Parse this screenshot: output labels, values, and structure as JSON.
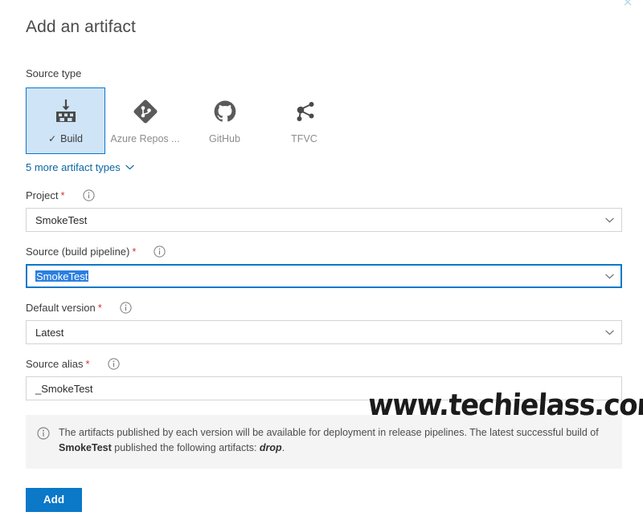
{
  "window": {
    "close_label": "✕"
  },
  "panel": {
    "title": "Add an artifact",
    "source_type_label": "Source type",
    "more_types_link": "5 more artifact types"
  },
  "source_types": [
    {
      "label": "Build",
      "icon": "build-icon",
      "selected": true,
      "check": "✓"
    },
    {
      "label": "Azure Repos ...",
      "icon": "azure-repos-icon",
      "selected": false
    },
    {
      "label": "GitHub",
      "icon": "github-icon",
      "selected": false
    },
    {
      "label": "TFVC",
      "icon": "tfvc-icon",
      "selected": false
    }
  ],
  "fields": {
    "project": {
      "label": "Project",
      "required": "*",
      "value": "SmokeTest",
      "type": "dropdown"
    },
    "source_build_pipeline": {
      "label": "Source (build pipeline)",
      "required": "*",
      "value": "SmokeTest",
      "type": "dropdown",
      "focused": true,
      "text_selected": true
    },
    "default_version": {
      "label": "Default version",
      "required": "*",
      "value": "Latest",
      "type": "dropdown"
    },
    "source_alias": {
      "label": "Source alias",
      "required": "*",
      "value": "_SmokeTest",
      "type": "text"
    }
  },
  "info_banner": {
    "icon": "info-icon",
    "text_part1": "The artifacts published by each version will be available for deployment in release pipelines. The latest successful build of ",
    "bold_build": "SmokeTest",
    "text_part2": " published the following artifacts: ",
    "italic_artifact": "drop",
    "text_part3": "."
  },
  "actions": {
    "add_label": "Add"
  },
  "watermark": {
    "text": "www.techielass.com"
  },
  "colors": {
    "accent": "#0b78c8",
    "selected_card_bg": "#cfe4f7",
    "required_star": "#d13438",
    "link": "#0b66a4",
    "banner_bg": "#f4f4f4",
    "text_selection": "#2a7fe0",
    "spellcheck_underline": "#c1272d"
  }
}
